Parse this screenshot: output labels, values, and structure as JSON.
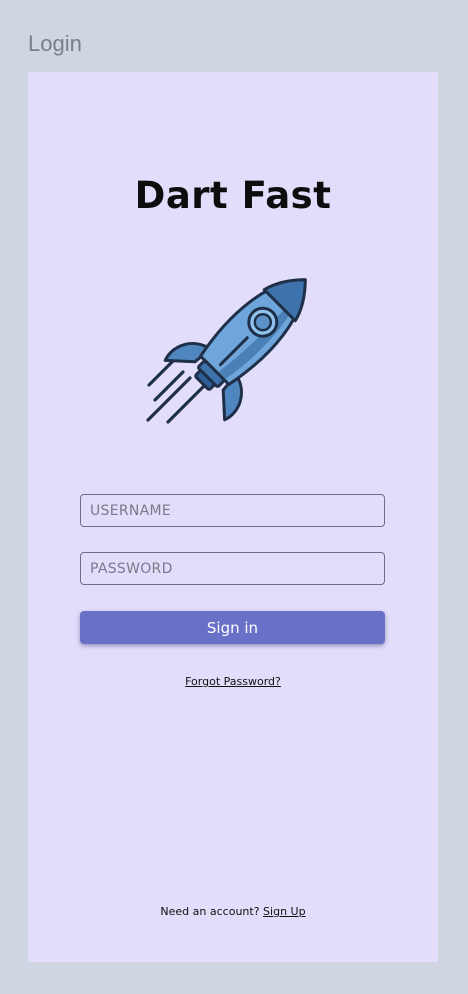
{
  "page": {
    "label": "Login"
  },
  "app": {
    "title": "Dart Fast",
    "logo_icon": "rocket-icon"
  },
  "form": {
    "username_placeholder": "USERNAME",
    "password_placeholder": "PASSWORD",
    "sign_in_label": "Sign in",
    "forgot_password_label": "Forgot Password?"
  },
  "footer": {
    "prompt": "Need an account?",
    "sign_up_label": "Sign Up"
  },
  "colors": {
    "background": "#cfd5e1",
    "card": "#e1ddfb",
    "accent": "#6870c8",
    "rocket_body": "#5b93c9",
    "rocket_outline": "#1f2f48"
  }
}
